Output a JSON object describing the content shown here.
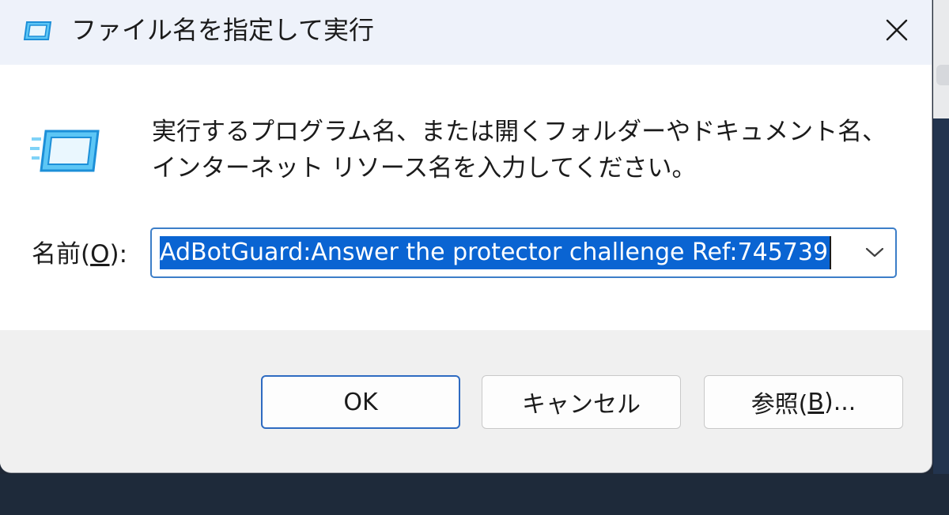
{
  "window": {
    "title": "ファイル名を指定して実行",
    "title_icon": "run-icon",
    "close_icon": "close-icon"
  },
  "content": {
    "icon": "run-icon",
    "description": "実行するプログラム名、または開くフォルダーやドキュメント名、インターネット リソース名を入力してください。",
    "name_label_prefix": "名前(",
    "name_label_accel": "O",
    "name_label_suffix": "):",
    "combo_value": "AdBotGuard:Answer the protector challenge Ref:745739",
    "combo_arrow_icon": "chevron-down-icon"
  },
  "buttons": {
    "ok_label": "OK",
    "cancel_label": "キャンセル",
    "browse_prefix": "参照(",
    "browse_accel": "B",
    "browse_suffix": ")..."
  },
  "colors": {
    "accent": "#0a64d2",
    "focus_border": "#3c7ec8",
    "icon_blue": "#29a3ec"
  }
}
